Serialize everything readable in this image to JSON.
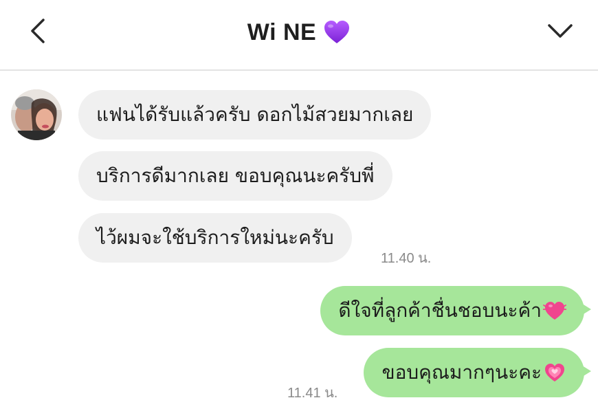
{
  "header": {
    "title": "Wi NE",
    "title_emoji": "purple-heart-icon",
    "back_icon": "chevron-left-icon",
    "menu_icon": "chevron-down-icon"
  },
  "messages": [
    {
      "side": "in",
      "text": "แฟนได้รับแล้วครับ ดอกไม้สวยมากเลย"
    },
    {
      "side": "in",
      "text": "บริการดีมากเลย ขอบคุณนะครับพี่"
    },
    {
      "side": "in",
      "text": "ไว้ผมจะใช้บริการใหม่นะครับ"
    },
    {
      "side": "out",
      "text": "ดีใจที่ลูกค้าชื่นชอบนะค้า",
      "emoji": "beating-heart-icon"
    },
    {
      "side": "out",
      "text": "ขอบคุณมากๆนะคะ",
      "emoji": "sparkling-heart-icon"
    }
  ],
  "timestamps": {
    "incoming": "11.40 น.",
    "outgoing": "11.41 น."
  },
  "colors": {
    "incoming_bubble": "#f0f0f0",
    "outgoing_bubble": "#a6e69a",
    "purple_heart": "#9b3ff0",
    "pink_heart": "#f0458e"
  }
}
